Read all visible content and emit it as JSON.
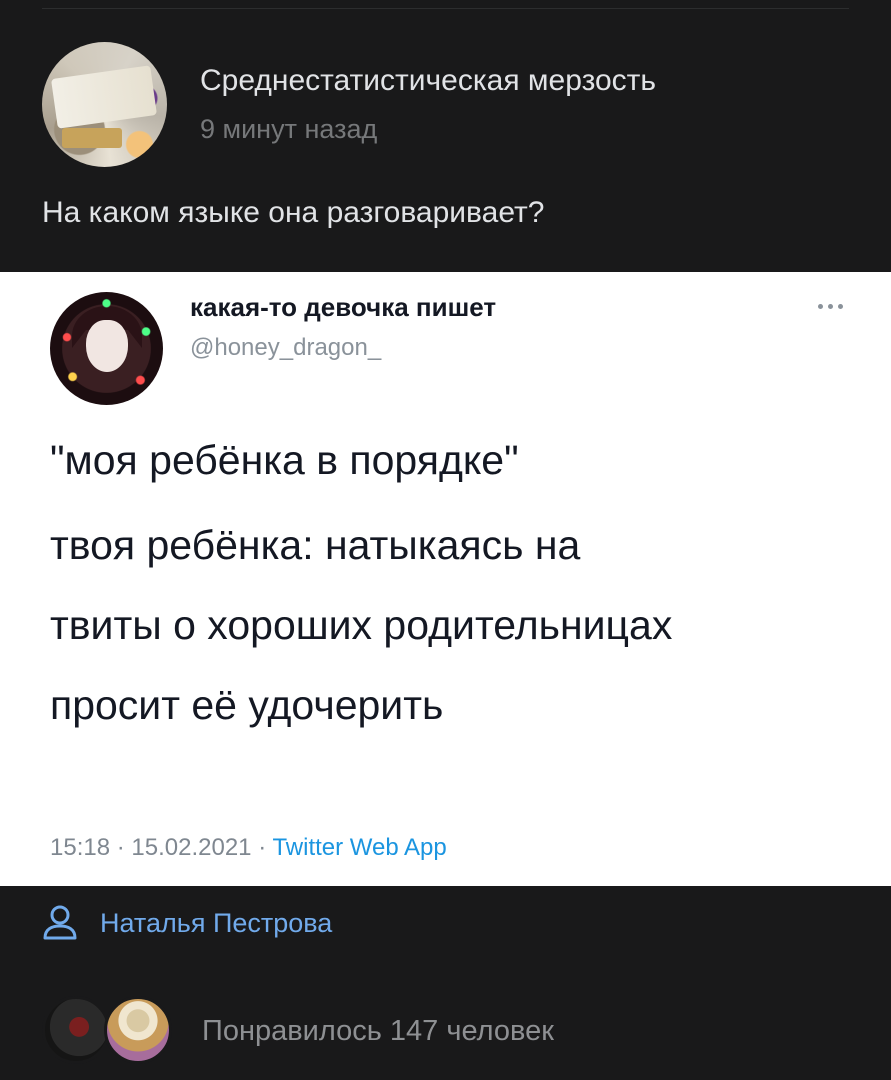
{
  "post": {
    "author": "Среднестатистическая мерзость",
    "time": "9 минут назад",
    "text": "На каком языке она разговаривает?"
  },
  "tweet": {
    "name": "какая-то девочка пишет",
    "handle": "@honey_dragon_",
    "line1": "\"моя ребёнка в порядке\"",
    "line2": "твоя ребёнка: натыкаясь на\nтвиты о хороших родительницах\nпросит её удочерить",
    "time": "15:18",
    "date": "15.02.2021",
    "source": "Twitter Web App",
    "separator": "·"
  },
  "author_link": {
    "label": "Наталья Пестрова",
    "icon": "user-icon"
  },
  "likes": {
    "text": "Понравилось 147 человек"
  },
  "colors": {
    "background": "#19191a",
    "link": "#71aaeb",
    "twitter_blue": "#1b95e0"
  }
}
